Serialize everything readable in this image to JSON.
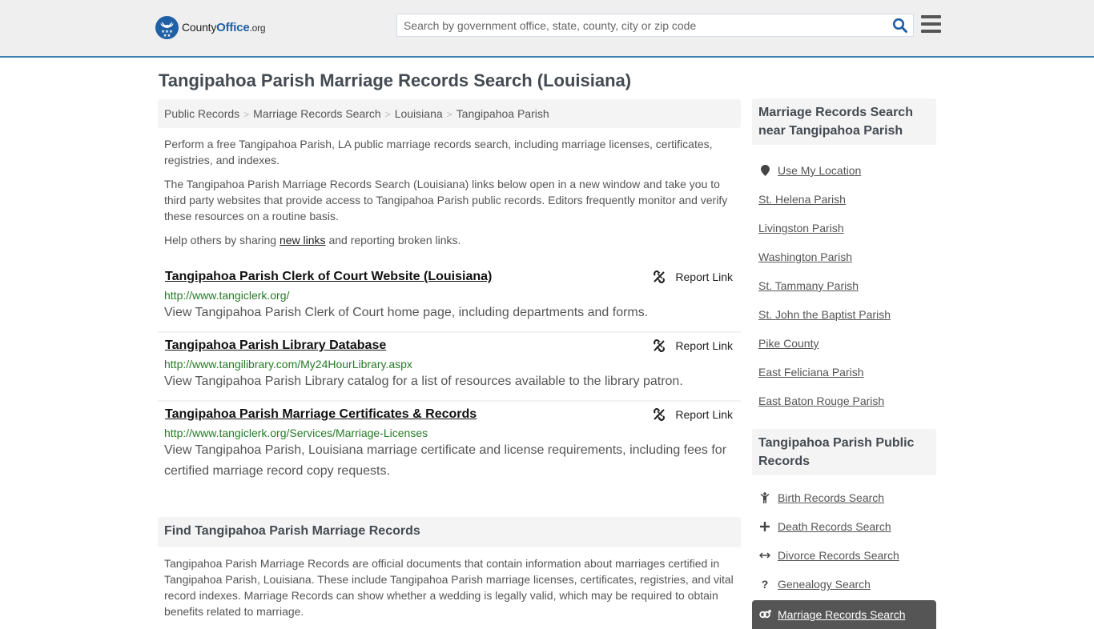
{
  "header": {
    "logo": {
      "brand_left": "County",
      "brand_right": "Office",
      "tld": ".org"
    },
    "search": {
      "placeholder": "Search by government office, state, county, city or zip code",
      "value": "",
      "icon": "search-icon"
    },
    "menu_icon": "hamburger-menu-icon",
    "accent_color": "#3c7fb1"
  },
  "page": {
    "title": "Tangipahoa Parish Marriage Records Search (Louisiana)"
  },
  "breadcrumb": [
    {
      "label": "Public Records"
    },
    {
      "label": "Marriage Records Search"
    },
    {
      "label": "Louisiana"
    },
    {
      "label": "Tangipahoa Parish"
    }
  ],
  "breadcrumb_separator": ">",
  "intro": {
    "p1": "Perform a free Tangipahoa Parish, LA public marriage records search, including marriage licenses, certificates, registries, and indexes.",
    "p2": "The Tangipahoa Parish Marriage Records Search (Louisiana) links below open in a new window and take you to third party websites that provide access to Tangipahoa Parish public records. Editors frequently monitor and verify these resources on a routine basis.",
    "p3_before": "Help others by sharing ",
    "p3_link": "new links",
    "p3_after": " and reporting broken links."
  },
  "results": [
    {
      "title": "Tangipahoa Parish Clerk of Court Website (Louisiana)",
      "url": "http://www.tangiclerk.org/",
      "description": "View Tangipahoa Parish Clerk of Court home page, including departments and forms.",
      "report_label": "Report Link"
    },
    {
      "title": "Tangipahoa Parish Library Database",
      "url": "http://www.tangilibrary.com/My24HourLibrary.aspx",
      "description": "View Tangipahoa Parish Library catalog for a list of resources available to the library patron.",
      "report_label": "Report Link"
    },
    {
      "title": "Tangipahoa Parish Marriage Certificates & Records",
      "url": "http://www.tangiclerk.org/Services/Marriage-Licenses",
      "description": "View Tangipahoa Parish, Louisiana marriage certificate and license requirements, including fees for certified marriage record copy requests.",
      "report_label": "Report Link"
    }
  ],
  "find": {
    "heading": "Find Tangipahoa Parish Marriage Records",
    "text": "Tangipahoa Parish Marriage Records are official documents that contain information about marriages certified in Tangipahoa Parish, Louisiana. These include Tangipahoa Parish marriage licenses, certificates, registries, and vital record indexes. Marriage Records can show whether a wedding is legally valid, which may be required to obtain benefits related to marriage."
  },
  "sidebar_nearby": {
    "heading": "Marriage Records Search near Tangipahoa Parish",
    "use_location": "Use My Location",
    "items": [
      "St. Helena Parish",
      "Livingston Parish",
      "Washington Parish",
      "St. Tammany Parish",
      "St. John the Baptist Parish",
      "Pike County",
      "East Feliciana Parish",
      "East Baton Rouge Parish"
    ]
  },
  "sidebar_public": {
    "heading": "Tangipahoa Parish Public Records",
    "items": [
      {
        "label": "Birth Records Search",
        "icon": "child-icon",
        "glyph": "὇6"
      },
      {
        "label": "Death Records Search",
        "icon": "plus-icon",
        "glyph": "+"
      },
      {
        "label": "Divorce Records Search",
        "icon": "arrows-horizontal-icon",
        "glyph": "↔"
      },
      {
        "label": "Genealogy Search",
        "icon": "question-icon",
        "glyph": "?"
      },
      {
        "label": "Marriage Records Search",
        "icon": "venus-mars-icon",
        "glyph": "⚥",
        "active": true
      }
    ]
  }
}
